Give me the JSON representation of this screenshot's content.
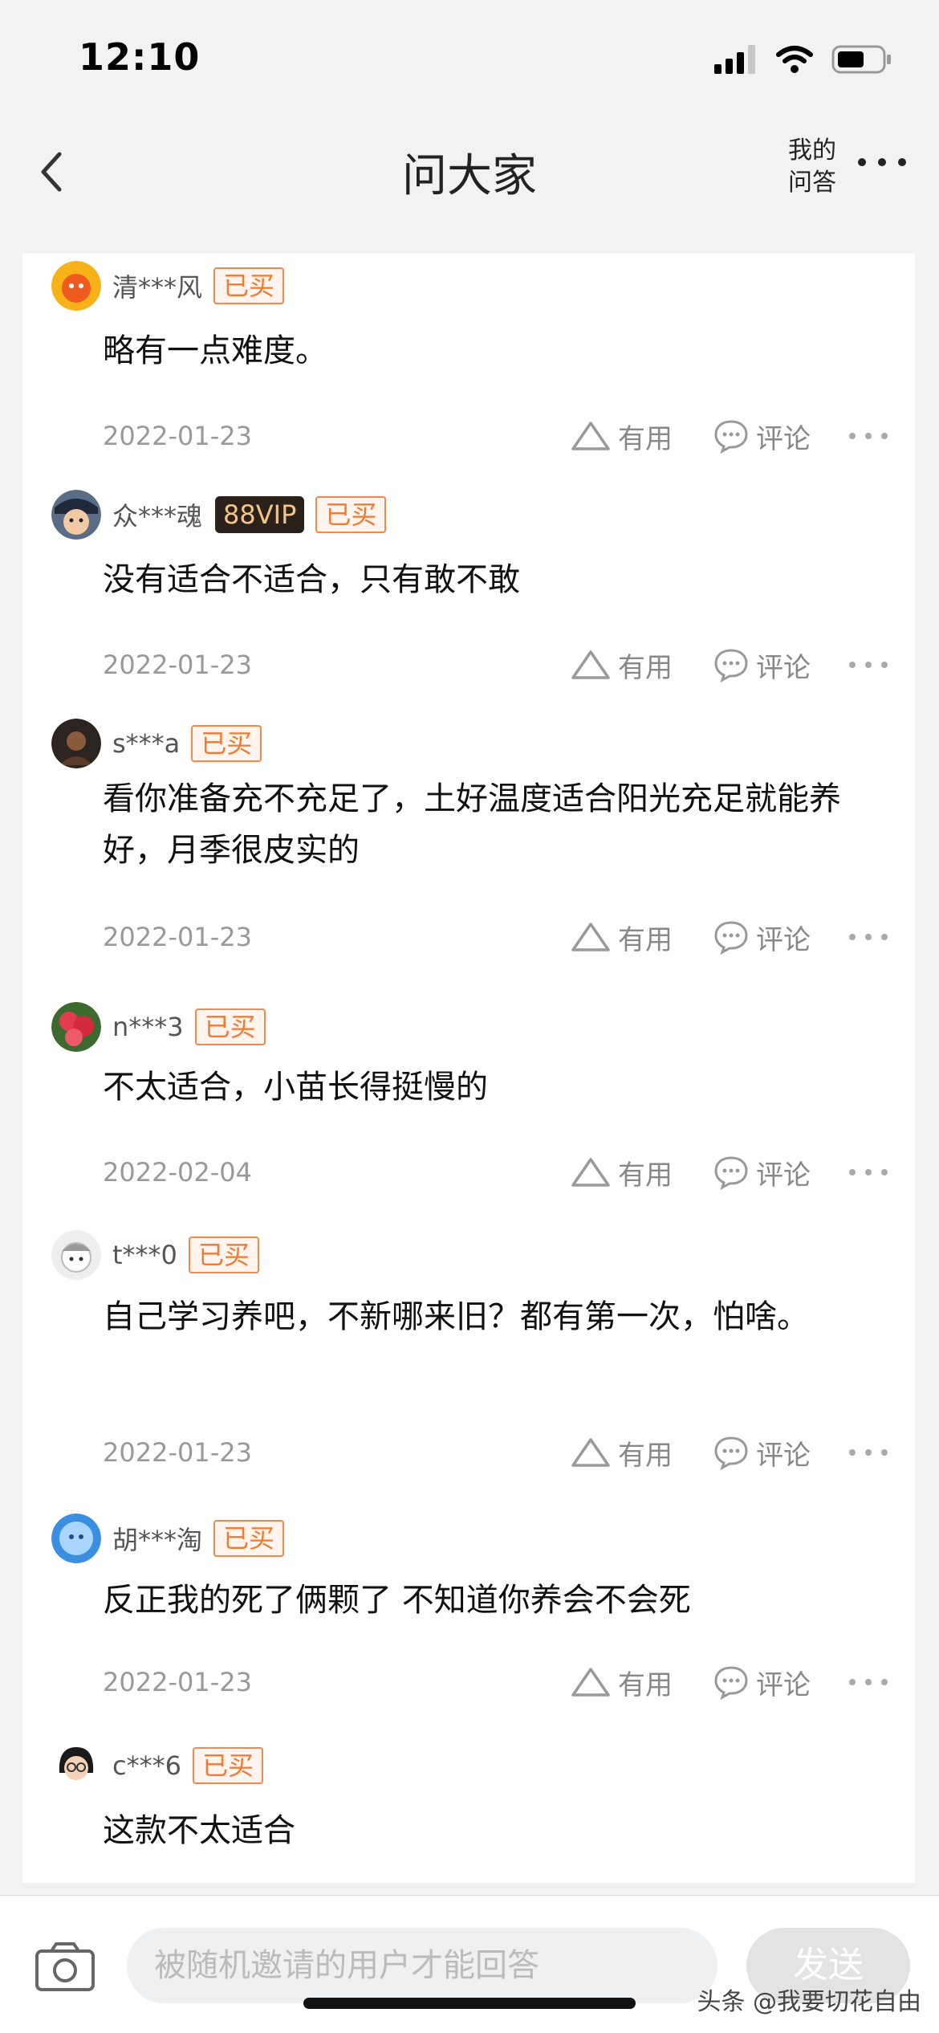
{
  "status": {
    "time": "12:10"
  },
  "nav": {
    "title": "问大家",
    "my_qa_line1": "我的",
    "my_qa_line2": "问答"
  },
  "actions": {
    "useful": "有用",
    "comment": "评论"
  },
  "answers": [
    {
      "user": "清***风",
      "badge": "已买",
      "text": "略有一点难度。",
      "date": "2022-01-23"
    },
    {
      "user": "众***魂",
      "vip": "88VIP",
      "badge": "已买",
      "text": "没有适合不适合，只有敢不敢",
      "date": "2022-01-23"
    },
    {
      "user": "s***a",
      "badge": "已买",
      "text": "看你准备充不充足了，土好温度适合阳光充足就能养好，月季很皮实的",
      "date": "2022-01-23"
    },
    {
      "user": "n***3",
      "badge": "已买",
      "text": "不太适合，小苗长得挺慢的",
      "date": "2022-02-04"
    },
    {
      "user": "t***0",
      "badge": "已买",
      "text": "自己学习养吧，不新哪来旧？都有第一次，怕啥。",
      "date": "2022-01-23"
    },
    {
      "user": "胡***淘",
      "badge": "已买",
      "text": "反正我的死了俩颗了  不知道你养会不会死",
      "date": "2022-01-23"
    },
    {
      "user": "c***6",
      "badge": "已买",
      "text": "这款不太适合"
    }
  ],
  "bottom": {
    "placeholder": "被随机邀请的用户才能回答",
    "send": "发送"
  },
  "watermark": "头条 @我要切花自由",
  "icons": [
    "back-icon",
    "more-icon",
    "signal-icon",
    "wifi-icon",
    "battery-icon",
    "thumb-up-icon",
    "comment-icon",
    "camera-icon"
  ],
  "colors": {
    "badge": "#f07a30",
    "vip_bg": "#2a211b",
    "vip_text": "#f3c48a",
    "meta": "#999999"
  }
}
